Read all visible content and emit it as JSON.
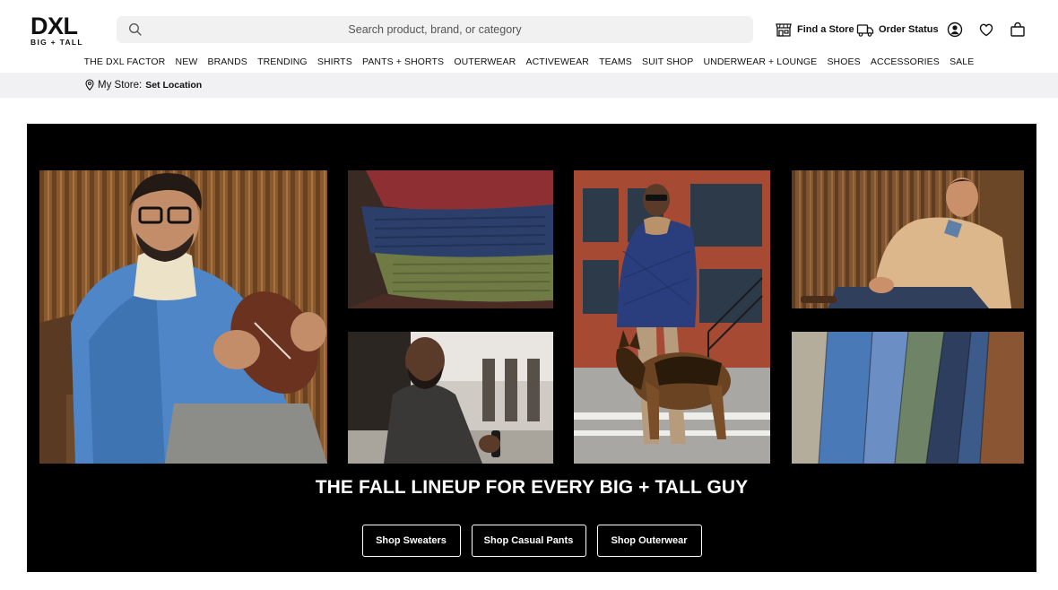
{
  "brand": {
    "logo_main": "DXL",
    "logo_sub": "BIG + TALL"
  },
  "search": {
    "placeholder": "Search product, brand, or category"
  },
  "utilities": {
    "find_store": "Find a Store",
    "order_status": "Order Status",
    "icons": [
      "store-icon",
      "truck-icon",
      "account-icon",
      "heart-icon",
      "bag-icon"
    ]
  },
  "nav": {
    "items": [
      "THE DXL FACTOR",
      "NEW",
      "BRANDS",
      "TRENDING",
      "SHIRTS",
      "PANTS + SHORTS",
      "OUTERWEAR",
      "ACTIVEWEAR",
      "TEAMS",
      "SUIT SHOP",
      "UNDERWEAR + LOUNGE",
      "SHOES",
      "ACCESSORIES",
      "SALE"
    ]
  },
  "store": {
    "label": "My Store:",
    "action": "Set Location"
  },
  "hero": {
    "title": "THE FALL LINEUP FOR EVERY BIG + TALL GUY",
    "buttons": [
      "Shop Sweaters",
      "Shop Casual Pants",
      "Shop Outerwear"
    ]
  },
  "colors": {
    "search_bg": "#f1f1f1",
    "store_bar_bg": "#f1f1f3",
    "hero_bg": "#000000",
    "text": "#111111"
  }
}
